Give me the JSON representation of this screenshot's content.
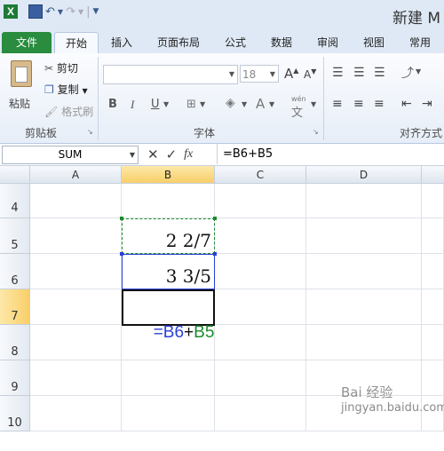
{
  "window": {
    "doc_title": "新建 M"
  },
  "tabs": [
    "文件",
    "开始",
    "插入",
    "页面布局",
    "公式",
    "数据",
    "审阅",
    "视图",
    "常用"
  ],
  "clipboard": {
    "paste": "粘贴",
    "cut": "剪切",
    "copy": "复制",
    "format_painter": "格式刷",
    "group": "剪贴板"
  },
  "font": {
    "size": "18",
    "group": "字体",
    "bold": "B",
    "italic": "I",
    "underline": "U",
    "grow": "A",
    "shrink": "A",
    "color": "A",
    "wen": "wén"
  },
  "alignment": {
    "group": "对齐方式"
  },
  "formula_bar": {
    "name_box": "SUM",
    "formula": "=B6+B5"
  },
  "columns": [
    "A",
    "B",
    "C",
    "D"
  ],
  "rows": [
    "4",
    "5",
    "6",
    "7",
    "8",
    "9",
    "10"
  ],
  "cells": {
    "B5": "2 2/7",
    "B6": "3 3/5",
    "B7_a": "=",
    "B7_b": "B6",
    "B7_c": "+",
    "B7_d": "B5"
  },
  "colors": {
    "ref_b6": "#2a3fd6",
    "ref_b5": "#1c8a2c",
    "accent": "#2a8c3f",
    "selected_header": "#f8cf6a"
  },
  "watermark": "jingyan.baidu.com"
}
